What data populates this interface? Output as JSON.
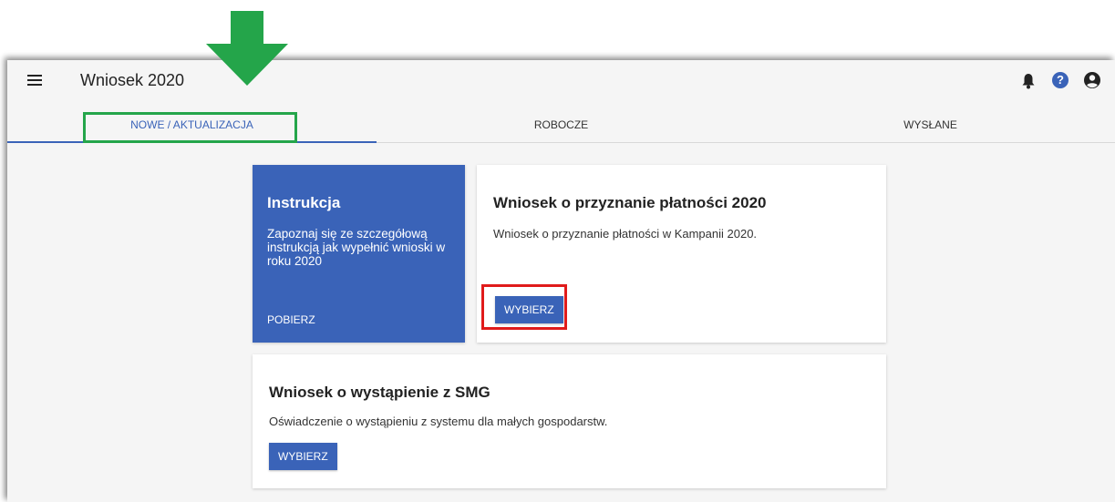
{
  "app": {
    "title": "Wniosek 2020"
  },
  "header": {
    "icons": [
      "menu-icon",
      "bell-icon",
      "help-icon",
      "account-icon"
    ],
    "help_glyph": "?"
  },
  "tabs": [
    {
      "label": "NOWE / AKTUALIZACJA",
      "active": true
    },
    {
      "label": "ROBOCZE",
      "active": false
    },
    {
      "label": "WYSŁANE",
      "active": false
    }
  ],
  "cards": {
    "instruction": {
      "title": "Instrukcja",
      "description": "Zapoznaj się ze szczegółową instrukcją jak wypełnić wnioski w roku 2020",
      "link": "POBIERZ"
    },
    "payment": {
      "title": "Wniosek o przyznanie płatności 2020",
      "description": "Wniosek o przyznanie płatności w Kampanii 2020.",
      "button": "WYBIERZ"
    },
    "smg": {
      "title": "Wniosek o wystąpienie z SMG",
      "description": "Oświadczenie o wystąpieniu z systemu dla małych gospodarstw.",
      "button": "WYBIERZ"
    }
  },
  "colors": {
    "accent": "#3a63b8",
    "annotation_green": "#24a54a",
    "annotation_red": "#e01b1b"
  }
}
